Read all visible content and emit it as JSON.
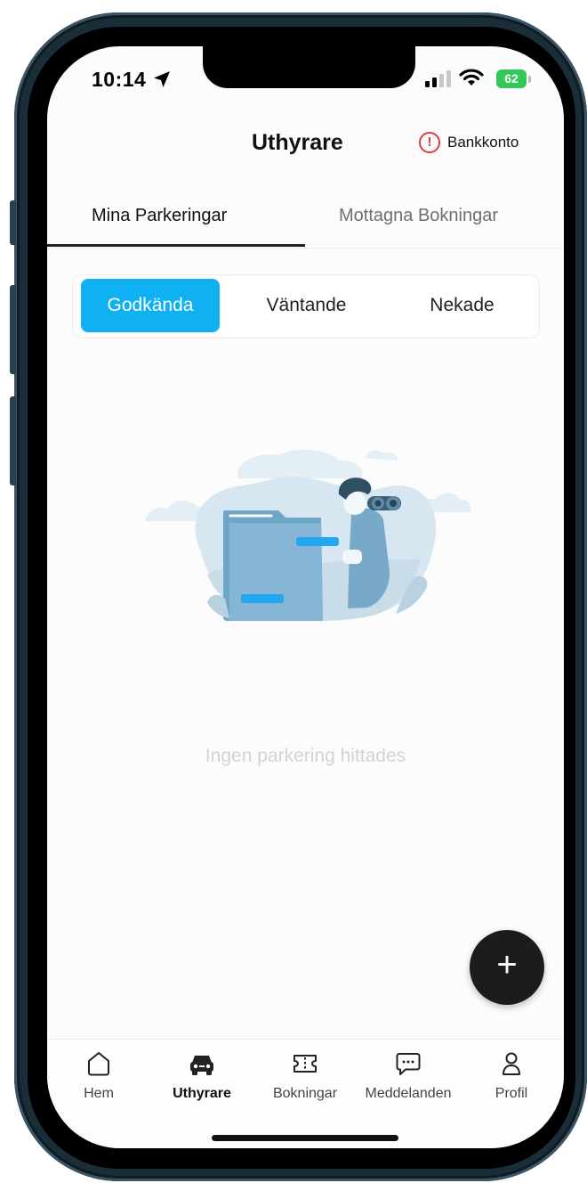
{
  "status_bar": {
    "time": "10:14",
    "battery": "62"
  },
  "header": {
    "title": "Uthyrare",
    "bank_link_label": "Bankkonto",
    "alert_glyph": "!"
  },
  "tabs": [
    {
      "label": "Mina Parkeringar",
      "active": true
    },
    {
      "label": "Mottagna Bokningar",
      "active": false
    }
  ],
  "segments": [
    {
      "label": "Godkända",
      "active": true
    },
    {
      "label": "Väntande",
      "active": false
    },
    {
      "label": "Nekade",
      "active": false
    }
  ],
  "empty_state": {
    "illustration": "person-with-binoculars-behind-folder",
    "message": "Ingen parkering hittades"
  },
  "fab": {
    "icon": "plus-icon",
    "glyph": "+"
  },
  "bottom_nav": [
    {
      "label": "Hem",
      "icon": "home-icon",
      "active": false
    },
    {
      "label": "Uthyrare",
      "icon": "car-icon",
      "active": true
    },
    {
      "label": "Bokningar",
      "icon": "ticket-icon",
      "active": false
    },
    {
      "label": "Meddelanden",
      "icon": "chat-icon",
      "active": false
    },
    {
      "label": "Profil",
      "icon": "profile-icon",
      "active": false
    }
  ],
  "colors": {
    "accent": "#10b1f3",
    "alert": "#e23b3b",
    "battery": "#34c759",
    "fab": "#1c1c1e",
    "frame": "#1a2e3a"
  }
}
